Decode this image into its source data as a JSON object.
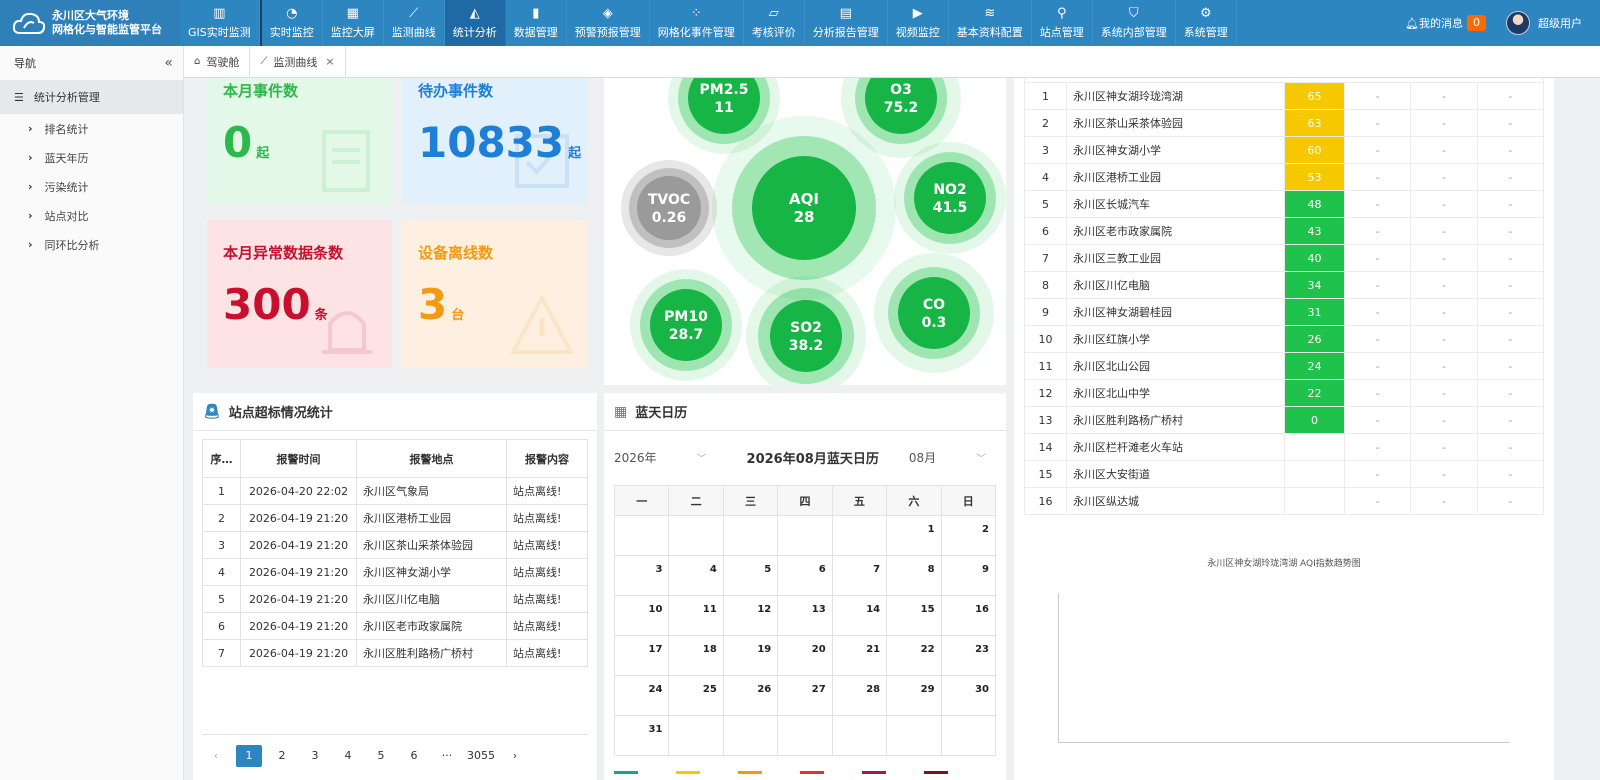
{
  "header": {
    "title_line1": "永川区大气环境",
    "title_line2": "网格化与智能监管平台",
    "nav": [
      {
        "label": "GIS实时监测",
        "icon": "map-icon"
      },
      {
        "label": "实时监控",
        "icon": "dashboard-icon"
      },
      {
        "label": "监控大屏",
        "icon": "grid-icon"
      },
      {
        "label": "监测曲线",
        "icon": "line-chart-icon"
      },
      {
        "label": "统计分析",
        "icon": "area-chart-icon"
      },
      {
        "label": "数据管理",
        "icon": "bar-chart-icon"
      },
      {
        "label": "预警预报管理",
        "icon": "cube-icon"
      },
      {
        "label": "网格化事件管理",
        "icon": "dots-grid-icon"
      },
      {
        "label": "考核评价",
        "icon": "book-icon"
      },
      {
        "label": "分析报告管理",
        "icon": "file-icon"
      },
      {
        "label": "视频监控",
        "icon": "play-icon"
      },
      {
        "label": "基本资料配置",
        "icon": "layers-icon"
      },
      {
        "label": "站点管理",
        "icon": "pin-icon"
      },
      {
        "label": "系统内部管理",
        "icon": "shield-icon"
      },
      {
        "label": "系统管理",
        "icon": "gears-icon"
      }
    ],
    "messages_label": "我的消息",
    "messages_count": "0",
    "user_label": "超级用户"
  },
  "sidebar": {
    "title": "导航",
    "collapse": "«",
    "group": "统计分析管理",
    "items": [
      "排名统计",
      "蓝天年历",
      "污染统计",
      "站点对比",
      "同环比分析"
    ]
  },
  "tabs": [
    {
      "label": "驾驶舱"
    },
    {
      "label": "监测曲线"
    }
  ],
  "cards": {
    "events": {
      "title": "本月事件数",
      "value": "0",
      "unit": "起"
    },
    "pending": {
      "title": "待办事件数",
      "value": "10833",
      "unit": "起"
    },
    "abnormal": {
      "title": "本月异常数据条数",
      "value": "300",
      "unit": "条"
    },
    "offline": {
      "title": "设备离线数",
      "value": "3",
      "unit": "台"
    }
  },
  "bubbles": [
    {
      "name": "PM2.5",
      "value": "11"
    },
    {
      "name": "O3",
      "value": "75.2"
    },
    {
      "name": "TVOC",
      "value": "0.26"
    },
    {
      "name": "AQI",
      "value": "28"
    },
    {
      "name": "NO2",
      "value": "41.5"
    },
    {
      "name": "PM10",
      "value": "28.7"
    },
    {
      "name": "SO2",
      "value": "38.2"
    },
    {
      "name": "CO",
      "value": "0.3"
    }
  ],
  "alarm": {
    "title": "站点超标情况统计",
    "headers": [
      "序…",
      "报警时间",
      "报警地点",
      "报警内容"
    ],
    "rows": [
      [
        "1",
        "2026-04-20 22:02",
        "永川区气象局",
        "站点离线!"
      ],
      [
        "2",
        "2026-04-19 21:20",
        "永川区港桥工业园",
        "站点离线!"
      ],
      [
        "3",
        "2026-04-19 21:20",
        "永川区茶山采茶体验园",
        "站点离线!"
      ],
      [
        "4",
        "2026-04-19 21:20",
        "永川区神女湖小学",
        "站点离线!"
      ],
      [
        "5",
        "2026-04-19 21:20",
        "永川区川亿电脑",
        "站点离线!"
      ],
      [
        "6",
        "2026-04-19 21:20",
        "永川区老市政家属院",
        "站点离线!"
      ],
      [
        "7",
        "2026-04-19 21:20",
        "永川区胜利路杨广桥村",
        "站点离线!"
      ]
    ],
    "pager": [
      "‹",
      "1",
      "2",
      "3",
      "4",
      "5",
      "6",
      "···",
      "3055",
      "›"
    ]
  },
  "calendar": {
    "title": "蓝天日历",
    "year": "2026年",
    "heading": "2026年08月蓝天日历",
    "month": "08月",
    "weekdays": [
      "一",
      "二",
      "三",
      "四",
      "五",
      "六",
      "日"
    ],
    "weeks": [
      [
        "",
        "",
        "",
        "",
        "",
        "1",
        "2"
      ],
      [
        "3",
        "4",
        "5",
        "6",
        "7",
        "8",
        "9"
      ],
      [
        "10",
        "11",
        "12",
        "13",
        "14",
        "15",
        "16"
      ],
      [
        "17",
        "18",
        "19",
        "20",
        "21",
        "22",
        "23"
      ],
      [
        "24",
        "25",
        "26",
        "27",
        "28",
        "29",
        "30"
      ],
      [
        "31",
        "",
        "",
        "",
        "",
        "",
        ""
      ]
    ],
    "legend_colors": [
      "#1aa38a",
      "#f5c800",
      "#f59a00",
      "#e0322c",
      "#9b1d4a",
      "#7a1020"
    ]
  },
  "ranking": {
    "rows": [
      {
        "n": "1",
        "site": "永川区神女湖玲珑湾湖",
        "aqi": "65",
        "level": "y"
      },
      {
        "n": "2",
        "site": "永川区茶山采茶体验园",
        "aqi": "63",
        "level": "y"
      },
      {
        "n": "3",
        "site": "永川区神女湖小学",
        "aqi": "60",
        "level": "y"
      },
      {
        "n": "4",
        "site": "永川区港桥工业园",
        "aqi": "53",
        "level": "y"
      },
      {
        "n": "5",
        "site": "永川区长城汽车",
        "aqi": "48",
        "level": "g"
      },
      {
        "n": "6",
        "site": "永川区老市政家属院",
        "aqi": "43",
        "level": "g"
      },
      {
        "n": "7",
        "site": "永川区三教工业园",
        "aqi": "40",
        "level": "g"
      },
      {
        "n": "8",
        "site": "永川区川亿电脑",
        "aqi": "34",
        "level": "g"
      },
      {
        "n": "9",
        "site": "永川区神女湖碧桂园",
        "aqi": "31",
        "level": "g"
      },
      {
        "n": "10",
        "site": "永川区红旗小学",
        "aqi": "26",
        "level": "g"
      },
      {
        "n": "11",
        "site": "永川区北山公园",
        "aqi": "24",
        "level": "g"
      },
      {
        "n": "12",
        "site": "永川区北山中学",
        "aqi": "22",
        "level": "g"
      },
      {
        "n": "13",
        "site": "永川区胜利路杨广桥村",
        "aqi": "0",
        "level": "g"
      },
      {
        "n": "14",
        "site": "永川区栏杆滩老火车站",
        "aqi": "",
        "level": ""
      },
      {
        "n": "15",
        "site": "永川区大安街道",
        "aqi": "",
        "level": ""
      },
      {
        "n": "16",
        "site": "永川区纵达城",
        "aqi": "",
        "level": ""
      }
    ],
    "dash": "-",
    "chart_title": "永川区神女湖玲珑湾湖 AQI指数趋势图"
  },
  "colors": {
    "nav": "#2e86c1",
    "green_card": "#e3f8e6",
    "blue_card": "#e2f0fc",
    "red_card": "#fde3e4",
    "orange_card": "#fdf0e0",
    "green_text": "#2cb84a",
    "blue_text": "#1e7fd6",
    "red_text": "#c8102e",
    "orange_text": "#f39a12"
  }
}
